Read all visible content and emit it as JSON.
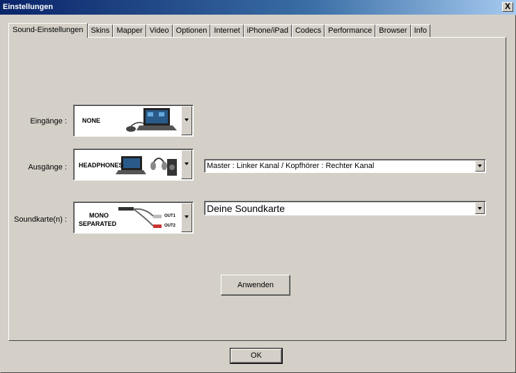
{
  "window": {
    "title": "Einstellungen",
    "close_label": "X"
  },
  "tabs": [
    {
      "label": "Sound-Einstellungen",
      "active": true
    },
    {
      "label": "Skins"
    },
    {
      "label": "Mapper"
    },
    {
      "label": "Video"
    },
    {
      "label": "Optionen"
    },
    {
      "label": "Internet"
    },
    {
      "label": "iPhone/iPad"
    },
    {
      "label": "Codecs"
    },
    {
      "label": "Performance"
    },
    {
      "label": "Browser"
    },
    {
      "label": "Info"
    }
  ],
  "inputs": {
    "label": "Eingänge :",
    "picker_text": "NONE"
  },
  "outputs": {
    "label": "Ausgänge :",
    "picker_text": "HEADPHONES",
    "mode_value": "Master : Linker Kanal / Kopfhörer : Rechter Kanal"
  },
  "soundcard": {
    "label": "Soundkarte(n) :",
    "picker_line1": "MONO",
    "picker_line2": "SEPARATED",
    "out1": "OUT1",
    "out2": "OUT2",
    "device_value": "Deine Soundkarte"
  },
  "buttons": {
    "apply": "Anwenden",
    "ok": "OK"
  }
}
